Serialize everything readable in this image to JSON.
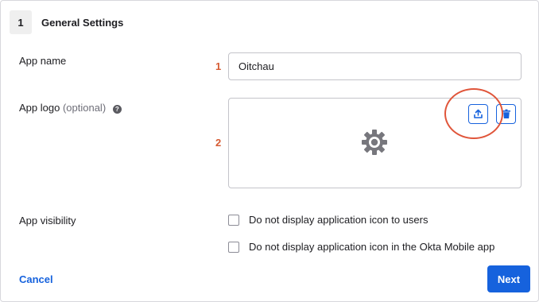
{
  "step": {
    "number": "1",
    "title": "General Settings"
  },
  "app_name": {
    "label": "App name",
    "value": "Oitchau",
    "annotation": "1"
  },
  "app_logo": {
    "label": "App logo",
    "optional_text": "(optional)",
    "help_icon": "question-circle-icon",
    "upload_icon": "upload-icon",
    "delete_icon": "trash-icon",
    "placeholder_icon": "gear-icon",
    "annotation": "2"
  },
  "app_visibility": {
    "label": "App visibility",
    "options": [
      {
        "label": "Do not display application icon to users",
        "checked": false
      },
      {
        "label": "Do not display application icon in the Okta Mobile app",
        "checked": false
      }
    ]
  },
  "actions": {
    "cancel_label": "Cancel",
    "next_label": "Next"
  },
  "colors": {
    "primary": "#1662dd",
    "annotation": "#d65b33",
    "highlight_ring": "#e0553a"
  }
}
